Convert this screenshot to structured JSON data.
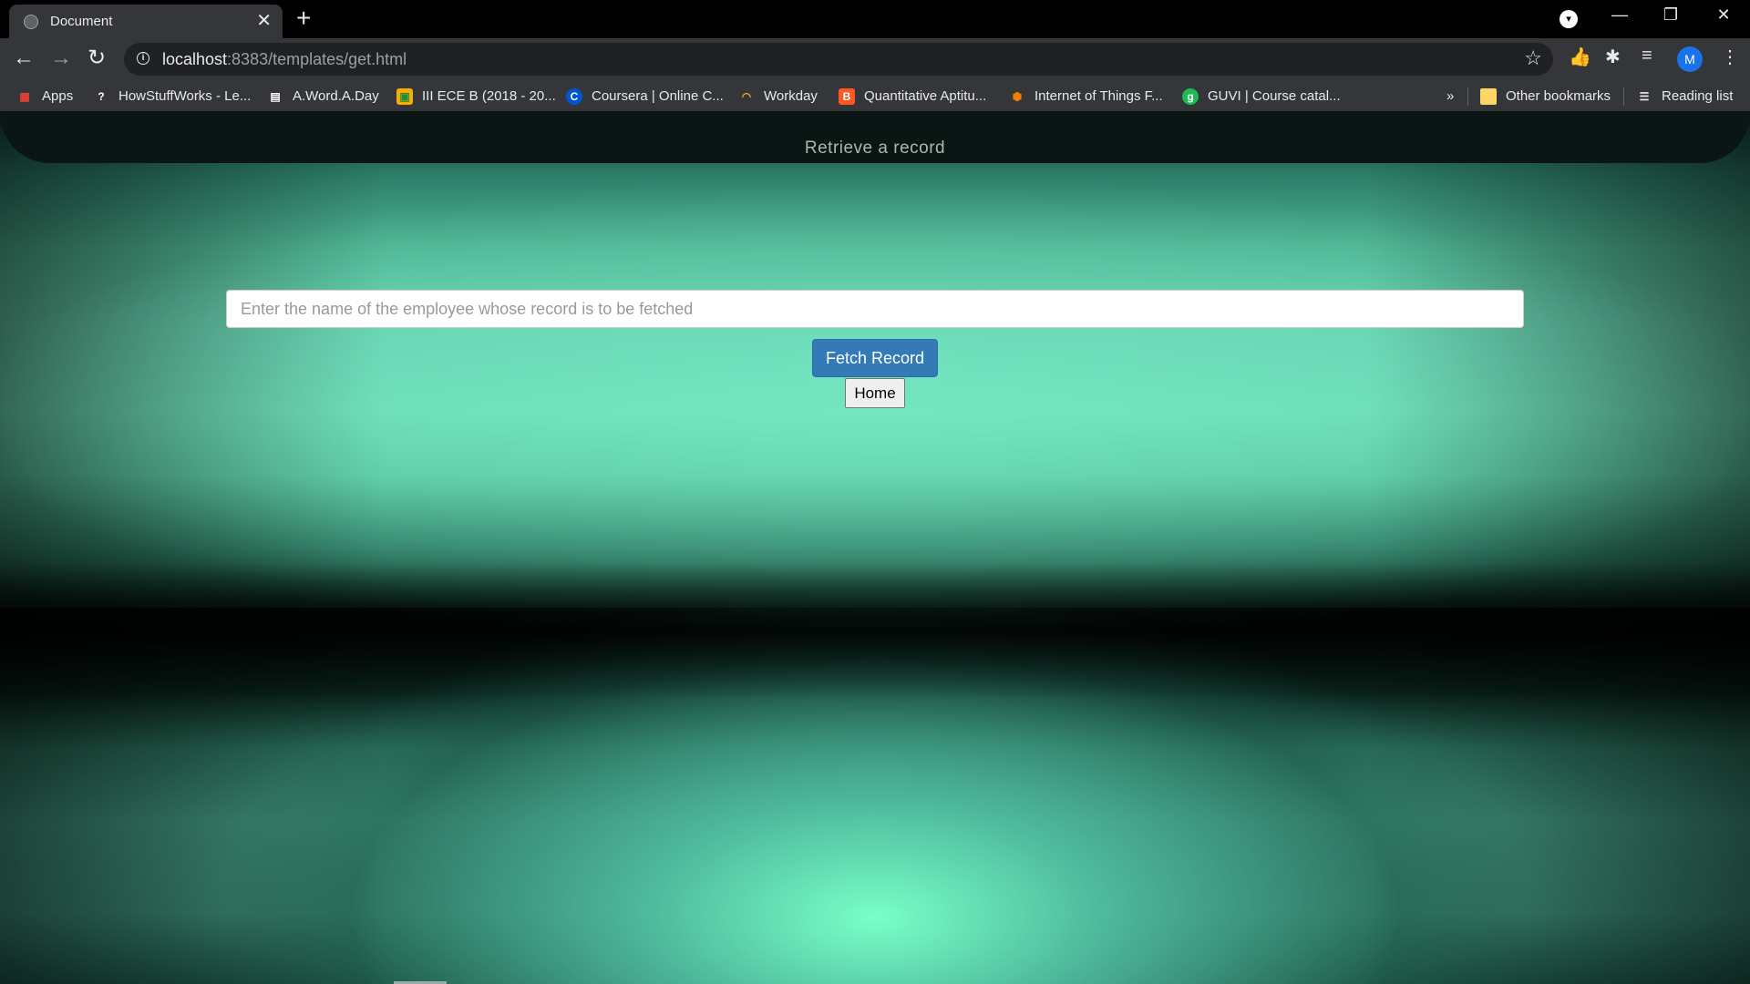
{
  "browser": {
    "tab": {
      "title": "Document",
      "close": "✕"
    },
    "new_tab": "+",
    "window_controls": {
      "minimize": "—",
      "restore": "❐",
      "close": "✕"
    },
    "url": {
      "host": "localhost",
      "rest": ":8383/templates/get.html"
    },
    "profile_initial": "M",
    "bookmarks": [
      {
        "label": "Apps",
        "icon": "apps-grid-icon",
        "color": "#ea4335"
      },
      {
        "label": "HowStuffWorks - Le...",
        "icon": "question-icon",
        "color": "#ffffff"
      },
      {
        "label": "A.Word.A.Day",
        "icon": "dictionary-icon",
        "color": "#ffffff"
      },
      {
        "label": "III ECE B (2018 - 20...",
        "icon": "classroom-icon",
        "color": "#f9ab00"
      },
      {
        "label": "Coursera | Online C...",
        "icon": "coursera-icon",
        "color": "#0056d2"
      },
      {
        "label": "Workday",
        "icon": "workday-icon",
        "color": "#f5a623"
      },
      {
        "label": "Quantitative Aptitu...",
        "icon": "blogger-icon",
        "color": "#ff5722"
      },
      {
        "label": "Internet of Things F...",
        "icon": "cube-icon",
        "color": "#f57c00"
      },
      {
        "label": "GUVI | Course catal...",
        "icon": "guvi-icon",
        "color": "#1db954"
      }
    ],
    "overflow": "»",
    "other_bookmarks": "Other bookmarks",
    "reading_list": "Reading list"
  },
  "page": {
    "header_title": "Retrieve a record",
    "search_placeholder": "Enter the name of the employee whose record is to be fetched",
    "fetch_button": "Fetch Record",
    "home_button": "Home"
  }
}
